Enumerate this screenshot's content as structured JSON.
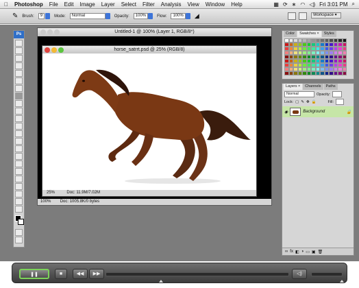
{
  "menubar": {
    "app": "Photoshop",
    "items": [
      "File",
      "Edit",
      "Image",
      "Layer",
      "Select",
      "Filter",
      "Analysis",
      "View",
      "Window",
      "Help"
    ],
    "clock": "Fri 3:01 PM"
  },
  "options": {
    "brush_label": "Brush:",
    "brush_size": "9",
    "mode_label": "Mode:",
    "mode_value": "Normal",
    "opacity_label": "Opacity:",
    "opacity_value": "100%",
    "flow_label": "Flow:",
    "flow_value": "100%",
    "workspace_label": "Workspace ▾"
  },
  "main_window": {
    "title": "Untitled-1 @ 100% (Layer 1, RGB/8*)",
    "zoom": "100%",
    "doc_info": "Doc: 1005.8K/0 bytes"
  },
  "doc_window": {
    "title": "horse_satrrt.psd @ 25% (RGB/8)",
    "zoom": "25%",
    "doc_info": "Doc: 11.9M/7.02M"
  },
  "swatches_panel": {
    "tabs": [
      "Color",
      "Swatches ×",
      "Styles"
    ]
  },
  "layers_panel": {
    "tabs": [
      "Layers ×",
      "Channels",
      "Paths"
    ],
    "blend_mode": "Normal",
    "opacity_label": "Opacity:",
    "lock_label": "Lock:",
    "fill_label": "Fill:",
    "layer_name": "Background"
  },
  "colors": {
    "accent_blue": "#3d74d8",
    "layer_selected": "#c6e6a7",
    "player_active_border": "#7cd35a"
  }
}
